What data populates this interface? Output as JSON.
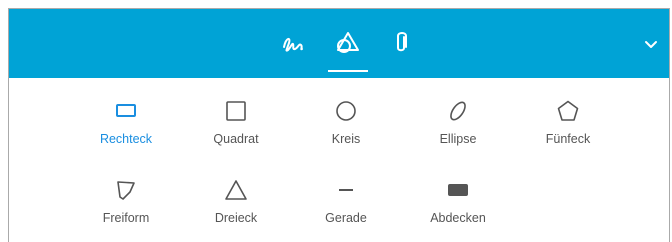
{
  "toolbar": {
    "background_color": "#00a3d6",
    "tabs": [
      {
        "icon": "freehand-pen-icon",
        "active": false
      },
      {
        "icon": "shapes-icon",
        "active": true
      },
      {
        "icon": "paperclip-icon",
        "active": false
      }
    ],
    "collapse_icon": "chevron-down-icon"
  },
  "shapes": {
    "selected_color": "#1a8ee0",
    "items": [
      {
        "label": "Rechteck",
        "icon": "rectangle-icon",
        "selected": true
      },
      {
        "label": "Quadrat",
        "icon": "square-icon",
        "selected": false
      },
      {
        "label": "Kreis",
        "icon": "circle-icon",
        "selected": false
      },
      {
        "label": "Ellipse",
        "icon": "ellipse-icon",
        "selected": false
      },
      {
        "label": "Fünfeck",
        "icon": "pentagon-icon",
        "selected": false
      },
      {
        "label": "Freiform",
        "icon": "freeform-icon",
        "selected": false
      },
      {
        "label": "Dreieck",
        "icon": "triangle-icon",
        "selected": false
      },
      {
        "label": "Gerade",
        "icon": "line-icon",
        "selected": false
      },
      {
        "label": "Abdecken",
        "icon": "cover-icon",
        "selected": false
      }
    ]
  }
}
